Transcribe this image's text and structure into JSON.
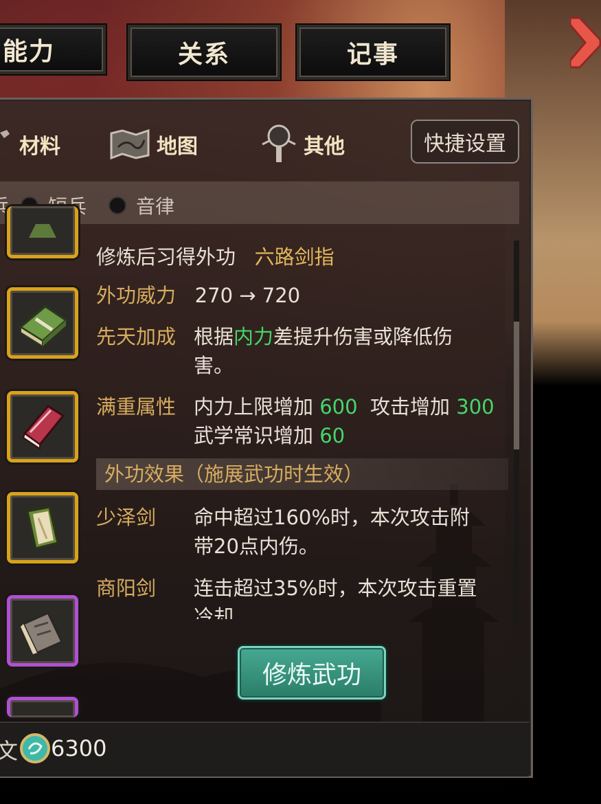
{
  "tabs": [
    "能力",
    "关系",
    "记事"
  ],
  "categories": {
    "material": "材料",
    "map": "地图",
    "other": "其他"
  },
  "shortcut_button": "快捷设置",
  "filters": [
    "短兵",
    "音律"
  ],
  "filter_partial_left": "兵",
  "detail": {
    "learn_label": "修炼后习得外功",
    "learn_value": "六路剑指",
    "power_label": "外功威力",
    "power_value": "270 → 720",
    "innate_label": "先天加成",
    "innate_prefix": "根据",
    "innate_highlight": "内力",
    "innate_suffix": "差提升伤害或降低伤",
    "innate_line2": "害。",
    "full_label": "满重属性",
    "full_part1": "内力上限增加",
    "full_val1": "600",
    "full_part2": "攻击增加",
    "full_val2": "300",
    "full_part3": "武学常识增加",
    "full_val3": "60",
    "section_title": "外功效果（施展武功时生效）",
    "effect1_name": "少泽剑",
    "effect1_line1": "命中超过160%时，本次攻击附",
    "effect1_line2": "带20点内伤。",
    "effect2_name": "商阳剑",
    "effect2_line1": "连击超过35%时，本次攻击重置",
    "effect2_line2": "冷却。"
  },
  "train_button": "修炼武功",
  "footer": {
    "partial_left": "文",
    "coin_value": "6300"
  },
  "colors": {
    "gold_label": "#d7ac5f",
    "green_value": "#45d66a",
    "slot_gold": "#d9a21a",
    "slot_purple": "#b24fd6",
    "button_teal": "#2a7d69"
  },
  "icons": [
    "pouch-icon",
    "map-icon",
    "tool-icon",
    "green-manual-icon",
    "red-book-icon",
    "scroll-icon",
    "gray-book-icon",
    "coin-icon",
    "arrow-right-icon"
  ]
}
